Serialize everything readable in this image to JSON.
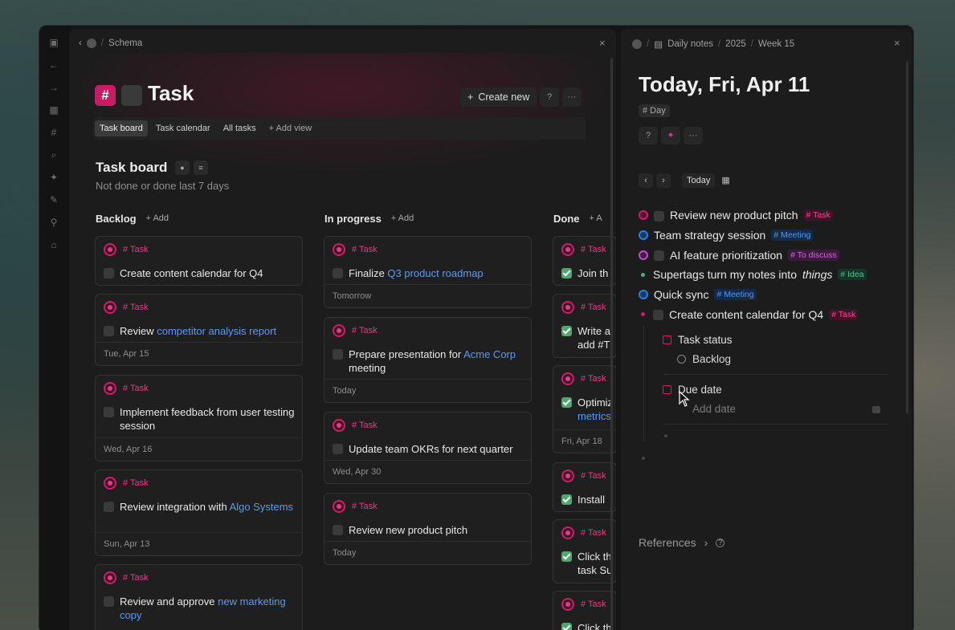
{
  "left_breadcrumb": {
    "title": "Schema"
  },
  "page": {
    "title": "Task",
    "create_label": "Create new",
    "info_icon": "?",
    "more_icon": "···"
  },
  "views": [
    "Task board",
    "Task calendar",
    "All tasks",
    "+  Add view"
  ],
  "board": {
    "title": "Task board",
    "subtitle": "Not done or done last 7 days"
  },
  "columns": [
    {
      "name": "Backlog",
      "add": "+  Add"
    },
    {
      "name": "In progress",
      "add": "+  Add"
    },
    {
      "name": "Done",
      "add": "+  A"
    }
  ],
  "tag_task": "# Task",
  "backlog": [
    {
      "pre": "Create content calendar for Q4",
      "link": "",
      "post": "",
      "date": ""
    },
    {
      "pre": "Review ",
      "link": "competitor analysis report",
      "post": "",
      "date": "Tue, Apr 15"
    },
    {
      "pre": "Implement feedback from user testing session",
      "link": "",
      "post": "",
      "date": "Wed, Apr 16"
    },
    {
      "pre": "Review integration with ",
      "link": "Algo Systems",
      "post": "",
      "date": "Sun, Apr 13"
    },
    {
      "pre": "Review and approve ",
      "link": "new marketing copy",
      "post": "",
      "date": ""
    }
  ],
  "inprogress": [
    {
      "pre": "Finalize ",
      "link": "Q3 product roadmap",
      "post": "",
      "date": "Tomorrow"
    },
    {
      "pre": "Prepare presentation for ",
      "link": "Acme Corp",
      "post": " meeting",
      "date": "Today"
    },
    {
      "pre": "Update team OKRs for next quarter",
      "link": "",
      "post": "",
      "date": "Wed, Apr 30"
    },
    {
      "pre": "Review new product pitch",
      "link": "",
      "post": "",
      "date": "Today"
    }
  ],
  "done": [
    {
      "pre": "Join th",
      "link": "",
      "post": "",
      "date": ""
    },
    {
      "pre": "Write a add #T",
      "link": "",
      "post": "",
      "date": ""
    },
    {
      "pre": "Optimiz ",
      "link": "metrics",
      "post": "",
      "date": "Fri, Apr 18"
    },
    {
      "pre": "Install ",
      "link": "",
      "post": "",
      "date": ""
    },
    {
      "pre": "Click th task Su",
      "link": "",
      "post": "",
      "date": ""
    },
    {
      "pre": "Click th",
      "link": "",
      "post": "",
      "date": ""
    }
  ],
  "right_breadcrumb": {
    "a": "Daily notes",
    "b": "2025",
    "c": "Week 15"
  },
  "daily": {
    "title": "Today, Fri, Apr 11",
    "day_tag": "# Day",
    "today_btn": "Today"
  },
  "entries": [
    {
      "bullet": "pink",
      "check": true,
      "text": "Review new product pitch",
      "tag": "# Task",
      "tagcls": "t-task"
    },
    {
      "bullet": "blue",
      "check": false,
      "text": "Team strategy session",
      "tag": "# Meeting",
      "tagcls": "t-meet"
    },
    {
      "bullet": "purple",
      "check": true,
      "text": "AI feature prioritization",
      "tag": "# To discuss",
      "tagcls": "t-disc"
    },
    {
      "bullet": "green",
      "check": false,
      "text": "Supertags turn my notes into ",
      "em": "things",
      "tag": "# Idea",
      "tagcls": "t-idea"
    },
    {
      "bullet": "blue",
      "check": false,
      "text": "Quick sync",
      "tag": "# Meeting",
      "tagcls": "t-meet"
    },
    {
      "bullet": "pinkdot",
      "check": true,
      "text": "Create content calendar for Q4",
      "tag": "# Task",
      "tagcls": "t-task"
    }
  ],
  "fields": {
    "status_label": "Task status",
    "status_value": "Backlog",
    "due_label": "Due date",
    "due_placeholder": "Add date"
  },
  "references": "References"
}
